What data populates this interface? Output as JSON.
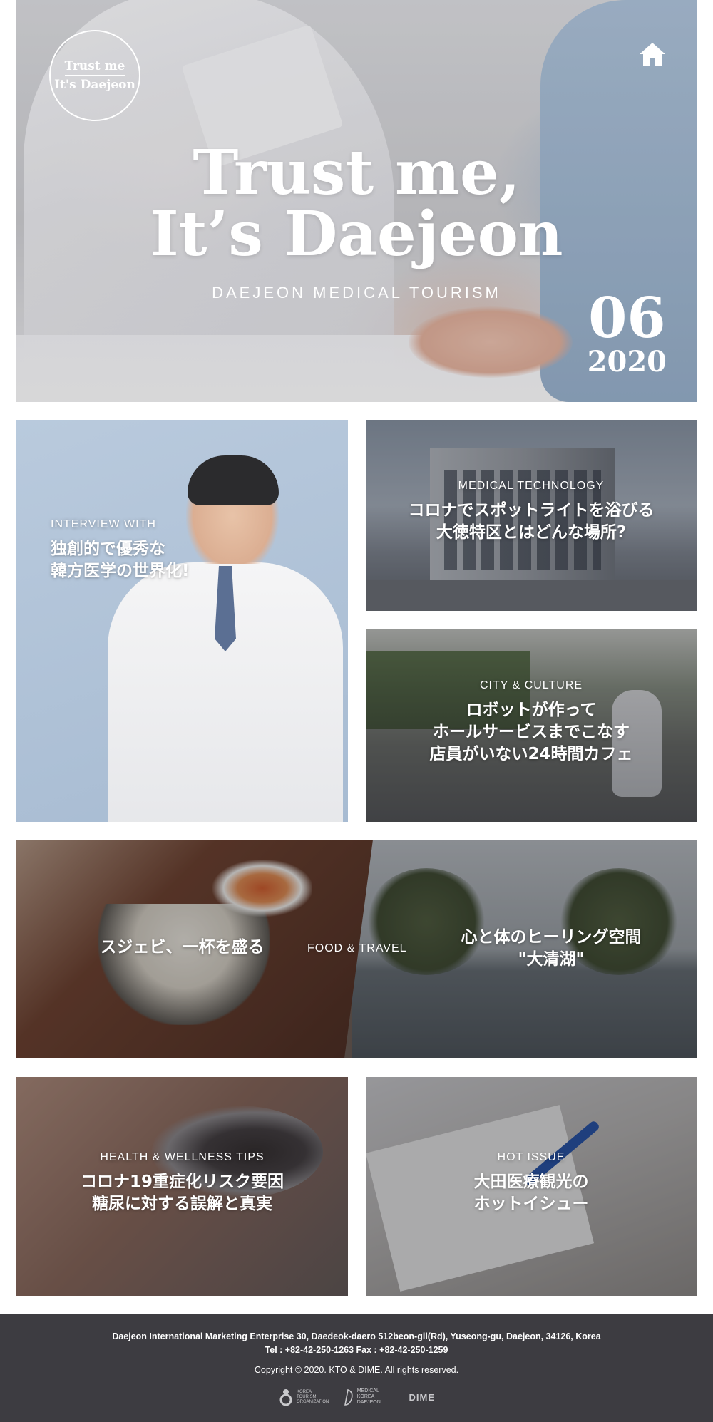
{
  "hero": {
    "logo_line1": "Trust me",
    "logo_line2": "It's Daejeon",
    "title_line1": "Trust me,",
    "title_line2": "It’s Daejeon",
    "subtitle": "DAEJEON MEDICAL TOURISM",
    "issue_month": "06",
    "issue_year": "2020",
    "home_icon": "home-icon"
  },
  "cards": {
    "interview": {
      "kicker": "INTERVIEW WITH",
      "headline_line1": "独創的で優秀な",
      "headline_line2": "韓方医学の世界化!"
    },
    "medtech": {
      "kicker": "MEDICAL TECHNOLOGY",
      "headline_line1": "コロナでスポットライトを浴びる",
      "headline_line2": "大徳特区とはどんな場所?"
    },
    "cafe": {
      "kicker": "CITY & CULTURE",
      "headline_line1": "ロボットが作って",
      "headline_line2": "ホールサービスまでこなす",
      "headline_line3": "店員がいない24時間カフェ"
    },
    "food_travel": {
      "kicker": "FOOD & TRAVEL",
      "left_headline": "スジェビ、一杯を盛る",
      "right_headline_line1": "心と体のヒーリング空間",
      "right_headline_line2": "\"大清湖\""
    },
    "health": {
      "kicker": "HEALTH & WELLNESS TIPS",
      "headline_line1": "コロナ19重症化リスク要因",
      "headline_line2": "糖尿に対する誤解と真実"
    },
    "hot": {
      "kicker": "HOT ISSUE",
      "headline_line1": "大田医療観光の",
      "headline_line2": "ホットイシュー"
    }
  },
  "footer": {
    "address": "Daejeon International Marketing Enterprise 30, Daedeok-daero 512beon-gil(Rd), Yuseong-gu, Daejeon, 34126, Korea",
    "tel": "Tel : +82-42-250-1263   Fax : +82-42-250-1259",
    "copyright": "Copyright © 2020. KTO & DIME. All rights reserved.",
    "logo1_text": "KOREA TOURISM ORGANIZATION",
    "logo2_text": "MEDICAL KOREA DAEJEON",
    "logo3_text": "DIME"
  }
}
